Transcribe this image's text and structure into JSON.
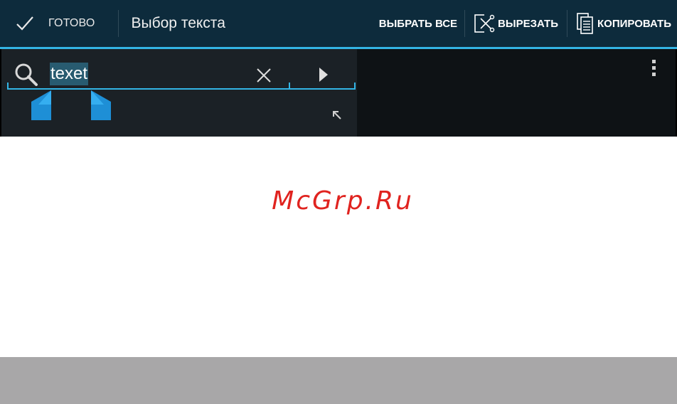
{
  "action_bar": {
    "done_label": "ГОТОВО",
    "title": "Выбор текста",
    "select_all_label": "ВЫБРАТЬ ВСЕ",
    "cut_label": "ВЫРЕЗАТЬ",
    "copy_label": "КОПИРОВАТЬ"
  },
  "search": {
    "query": "texet",
    "icons": {
      "search": "search-icon",
      "clear": "close-icon",
      "next": "play-icon",
      "expand": "arrow-up-left-icon",
      "overflow": "overflow-menu-icon"
    }
  },
  "watermark": {
    "text": "McGrp.Ru"
  },
  "colors": {
    "action_bar_bg": "#0d2b3c",
    "accent": "#33b5e5",
    "selection": "#285b70",
    "watermark": "#e0231f",
    "footer": "#a8a7a8"
  }
}
